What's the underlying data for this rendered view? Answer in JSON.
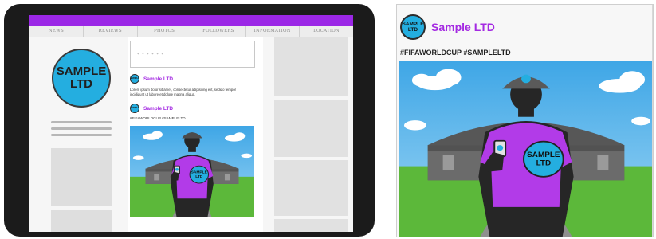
{
  "nav": {
    "items": [
      "NEWS",
      "REVIEWS",
      "PHOTOS",
      "FOLLOWERS",
      "INFORMATION",
      "LOCATION"
    ]
  },
  "profile": {
    "avatar_line1": "SAMPLE",
    "avatar_line2": "LTD"
  },
  "composer": {
    "placeholder": "* * * * * *"
  },
  "post1": {
    "author": "Sample LTD",
    "avatar_line1": "SAMPLE",
    "avatar_line2": "LTD",
    "text": "Lorem ipsum dolor sit amet, consectetur adipiscing elit, sedido tempor incididunt ut labore et dolore magna aliqua."
  },
  "post2": {
    "author": "Sample LTD",
    "avatar_line1": "SAMPLE",
    "avatar_line2": "LTD",
    "hashtags": "#FIFAWORLDCUP #SAMPLELTD",
    "shirt_badge_line1": "SAMPLE",
    "shirt_badge_line2": "LTD"
  },
  "card": {
    "author": "Sample LTD",
    "avatar_line1": "SAMPLE",
    "avatar_line2": "LTD",
    "hashtags": "#FIFAWORLDCUP #SAMPLELTD",
    "shirt_badge_line1": "SAMPLE",
    "shirt_badge_line2": "LTD"
  },
  "colors": {
    "brand_purple": "#9b27e6",
    "name_purple": "#a42ae2",
    "badge_blue": "#24aee0",
    "sky": "#5fb4ea",
    "grass": "#5cb83a"
  },
  "icons": {
    "profile_avatar": "company-logo-avatar",
    "cap_logo": "company-logo-icon"
  }
}
